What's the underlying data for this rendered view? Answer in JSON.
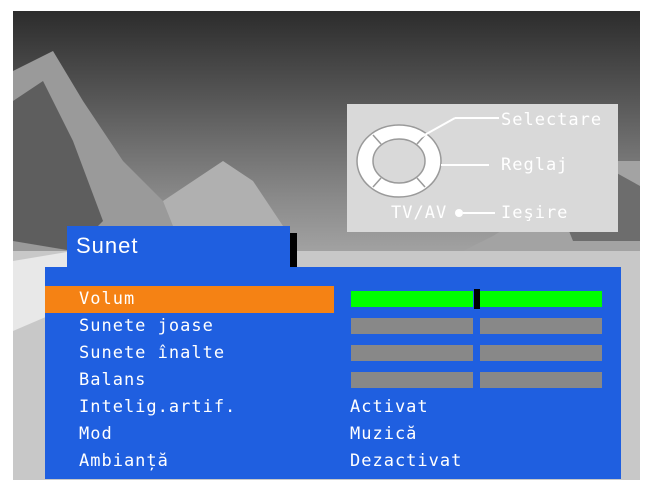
{
  "hint_panel": {
    "select_label": "Selectare",
    "adjust_label": "Reglaj",
    "tvav_label": "TV/AV",
    "exit_label": "Ieşire",
    "up_symbol": "∧",
    "down_symbol": "∨",
    "minus_symbol": "−",
    "plus_symbol": "+"
  },
  "menu": {
    "title": "Sunet",
    "items": [
      {
        "label": "Volum",
        "selected": true,
        "level": 0.5
      },
      {
        "label": "Sunete joase",
        "level": null
      },
      {
        "label": "Sunete înalte",
        "level": null
      },
      {
        "label": "Balans",
        "level": null
      },
      {
        "label": "Intelig.artif.",
        "value": "Activat"
      },
      {
        "label": "Mod",
        "value": "Muzică"
      },
      {
        "label": "Ambianță",
        "value": "Dezactivat"
      }
    ]
  },
  "colors": {
    "menu_blue": "#1f5fe0",
    "selected_orange": "#f58214",
    "active_bar_green": "#00ff00",
    "inactive_bar_gray": "#888888",
    "hint_panel_gray": "#d9d9d9"
  }
}
